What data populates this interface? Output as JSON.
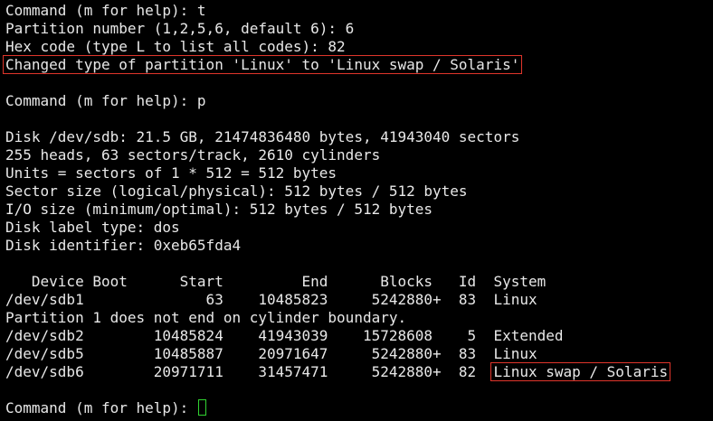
{
  "colors": {
    "background": "#000000",
    "text": "#e8e8e8",
    "highlight_box": "#e0352b",
    "cursor": "#31d331"
  },
  "lines": [
    "Command (m for help): t",
    "Partition number (1,2,5,6, default 6): 6",
    "Hex code (type L to list all codes): 82",
    "Changed type of partition 'Linux' to 'Linux swap / Solaris'",
    "",
    "Command (m for help): p",
    "",
    "Disk /dev/sdb: 21.5 GB, 21474836480 bytes, 41943040 sectors",
    "255 heads, 63 sectors/track, 2610 cylinders",
    "Units = sectors of 1 * 512 = 512 bytes",
    "Sector size (logical/physical): 512 bytes / 512 bytes",
    "I/O size (minimum/optimal): 512 bytes / 512 bytes",
    "Disk label type: dos",
    "Disk identifier: 0xeb65fda4",
    "",
    "   Device Boot      Start         End      Blocks   Id  System",
    "/dev/sdb1              63    10485823     5242880+  83  Linux",
    "Partition 1 does not end on cylinder boundary.",
    "/dev/sdb2        10485824    41943039    15728608    5  Extended",
    "/dev/sdb5        10485887    20971647     5242880+  83  Linux",
    "/dev/sdb6_prefix",
    "",
    "Command (m for help): "
  ],
  "highlighted": {
    "changed_type_message": "Changed type of partition 'Linux' to 'Linux swap / Solaris'",
    "sdb6_prefix": "/dev/sdb6        20971711    31457471     5242880+  82  ",
    "sdb6_system": "Linux swap / Solaris"
  },
  "prompt": {
    "text": "Command (m for help): "
  }
}
